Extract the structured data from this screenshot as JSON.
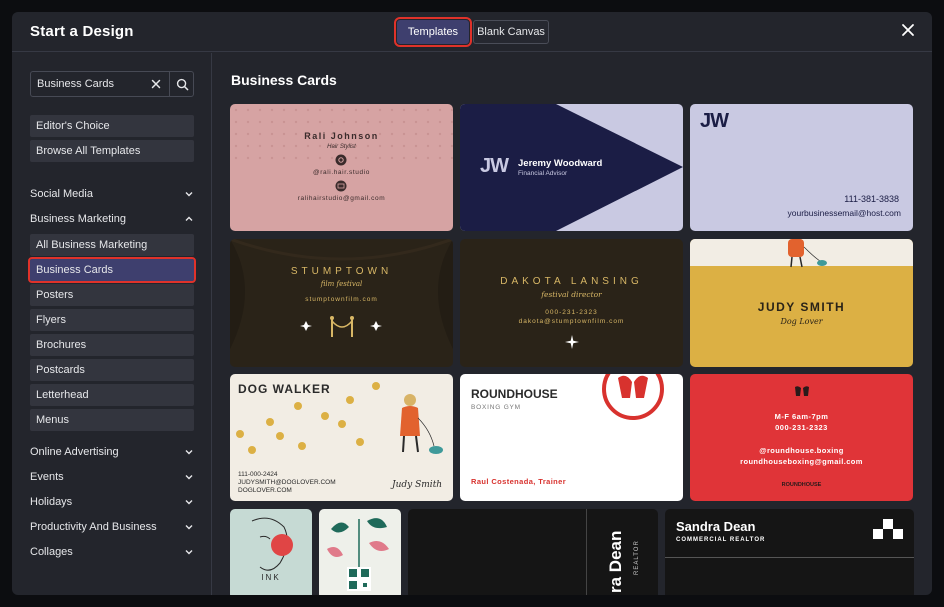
{
  "header": {
    "title": "Start a Design",
    "tabs": [
      {
        "label": "Templates",
        "active": true
      },
      {
        "label": "Blank Canvas",
        "active": false
      }
    ]
  },
  "sidebar": {
    "search": {
      "value": "Business Cards",
      "placeholder": ""
    },
    "top_links": [
      "Editor's Choice",
      "Browse All Templates"
    ],
    "categories": [
      {
        "label": "Social Media",
        "expanded": false
      },
      {
        "label": "Business Marketing",
        "expanded": true
      }
    ],
    "sub_items": [
      "All Business Marketing",
      "Business Cards",
      "Posters",
      "Flyers",
      "Brochures",
      "Postcards",
      "Letterhead",
      "Menus"
    ],
    "active_item": "Business Cards",
    "more_categories": [
      "Online Advertising",
      "Events",
      "Holidays",
      "Productivity And Business",
      "Collages"
    ]
  },
  "main": {
    "section_title": "Business Cards",
    "cards": {
      "rali": {
        "name": "Rali Johnson",
        "role": "Hair Stylist",
        "handle": "@rali.hair.studio",
        "email": "ralihairstudio@gmail.com"
      },
      "jeremy": {
        "logo": "JW",
        "name": "Jeremy Woodward",
        "role": "Financial Advisor"
      },
      "jw_plain": {
        "logo": "JW",
        "phone": "111-381-3838",
        "email": "yourbusinessemail@host.com"
      },
      "stumptown": {
        "name": "STUMPTOWN",
        "sub": "film festival",
        "url": "stumptownfilm.com"
      },
      "dakota": {
        "name": "DAKOTA LANSING",
        "role": "festival director",
        "phone": "000-231-2323",
        "email": "dakota@stumptownfilm.com"
      },
      "judy_yellow": {
        "name": "JUDY SMITH",
        "role": "Dog Lover"
      },
      "dogwalker": {
        "title": "DOG WALKER",
        "phone": "111-000-2424",
        "email": "JUDYSMITH@DOGLOVER.COM",
        "site": "DOGLOVER.COM",
        "signature": "Judy Smith"
      },
      "roundhouse": {
        "title": "ROUNDHOUSE",
        "sub": "BOXING GYM",
        "person": "Raul Costenada, Trainer"
      },
      "roundhouse_red": {
        "hours": "M-F 6am-7pm",
        "phone": "000-231-2323",
        "handle": "@roundhouse.boxing",
        "email": "roundhouseboxing@gmail.com",
        "brand": "ROUNDHOUSE"
      },
      "ink": {
        "label": "INK"
      },
      "dean_vertical": {
        "name": "ra Dean",
        "role": "REALTOR"
      },
      "sandra": {
        "name": "Sandra Dean",
        "role": "COMMERCIAL REALTOR"
      }
    }
  }
}
